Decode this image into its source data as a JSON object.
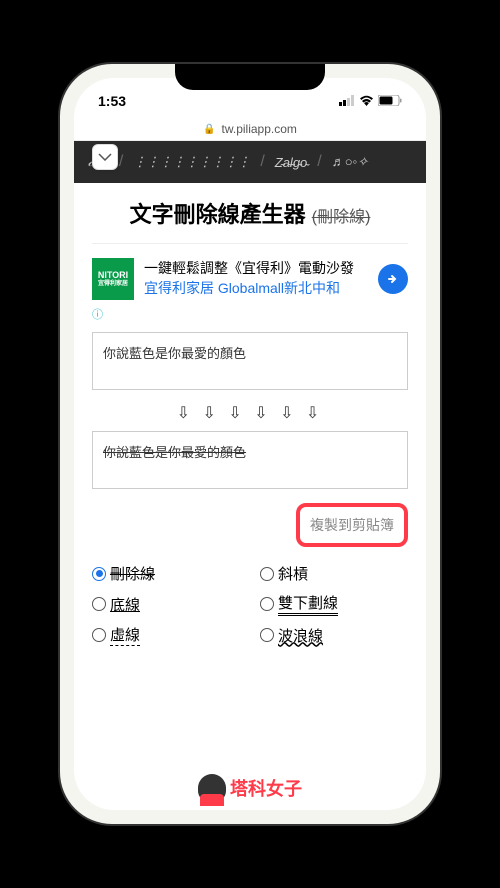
{
  "status": {
    "time": "1:53"
  },
  "browser": {
    "domain": "tw.piliapp.com"
  },
  "nav": {
    "tabs": [
      "𝒸𝑜𝑜𝓁",
      "⋮⋮⋮⋮⋮⋮⋮⋮⋮",
      "Z̴a̴l̴g̴o̴",
      "♬○◦✧"
    ]
  },
  "page": {
    "title": "文字刪除線產生器",
    "subtitle": "(刪除線)"
  },
  "ad": {
    "logo_top": "NITORI",
    "logo_bottom": "宜得利家居",
    "headline": "一鍵輕鬆調整《宜得利》電動沙發",
    "link": "宜得利家居 Globalmall新北中和",
    "info": "ⓘ"
  },
  "input": {
    "value": "你說藍色是你最愛的顏色"
  },
  "arrows": "⇩ ⇩ ⇩ ⇩ ⇩ ⇩",
  "output": {
    "value": "你說藍色是你最愛的顏色"
  },
  "copy_button": "複製到剪貼簿",
  "options": {
    "strikethrough": "刪除線",
    "slash": "斜槓",
    "underline": "底線",
    "double_underline": "雙下劃線",
    "dashed": "虛線",
    "wavy": "波浪線"
  },
  "footer": {
    "brand": "塔科女子"
  }
}
